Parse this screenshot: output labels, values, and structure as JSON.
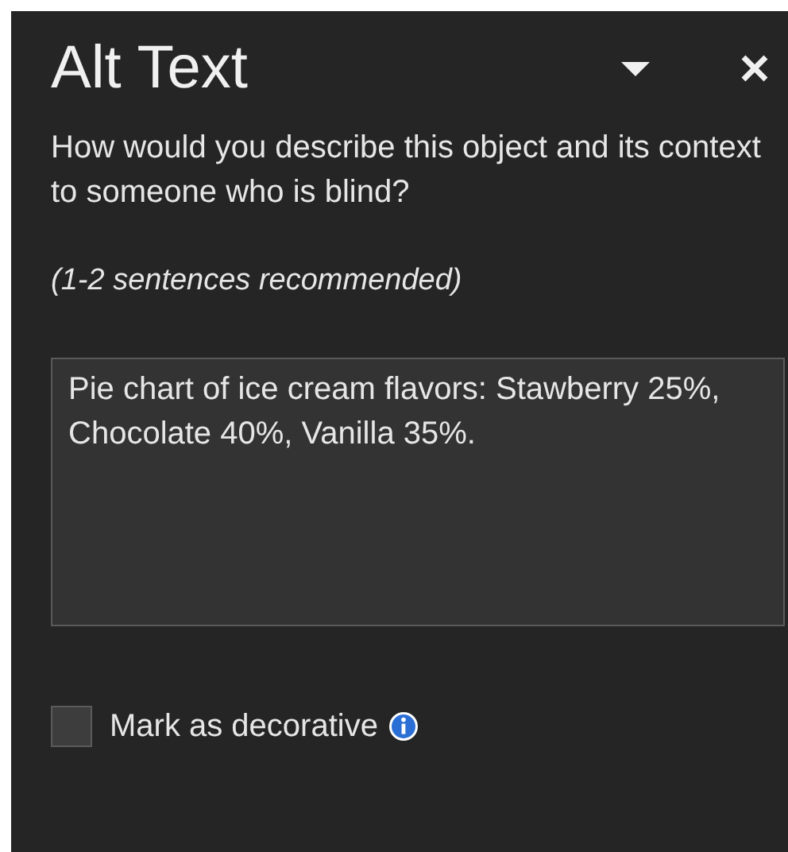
{
  "pane": {
    "title": "Alt Text",
    "question": "How would you describe this object and its context to someone who is blind?",
    "hint": "(1-2 sentences recommended)",
    "description": {
      "value": "Pie chart of ice cream flavors: Stawberry 25%, Chocolate 40%, Vanilla 35%."
    },
    "decorative": {
      "label": "Mark as decorative",
      "checked": false
    }
  }
}
